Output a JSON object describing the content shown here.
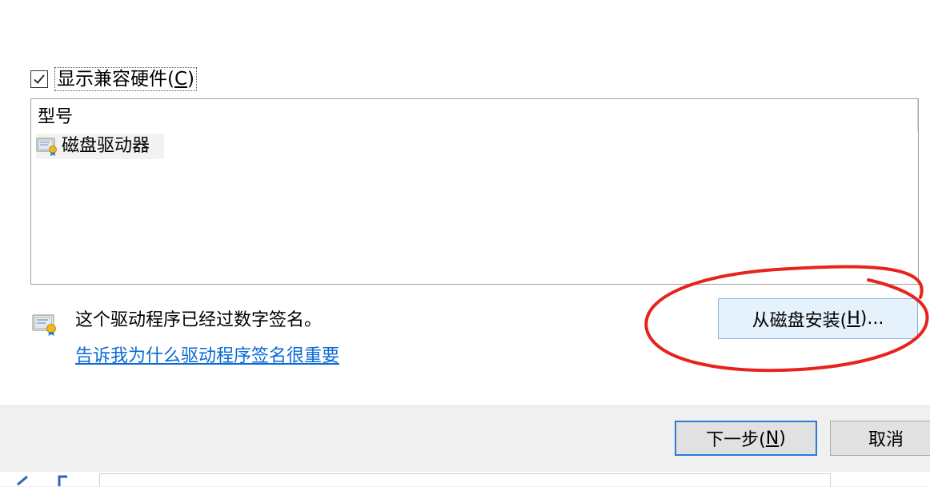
{
  "compat": {
    "label": "显示兼容硬件(C)",
    "label_pre": "显示兼容硬件(",
    "label_key": "C",
    "label_post": ")",
    "checked": true
  },
  "model_list": {
    "header": "型号",
    "items": [
      {
        "label": "磁盘驱动器",
        "icon": "driver-certificate-icon"
      }
    ]
  },
  "signed": {
    "text": "这个驱动程序已经过数字签名。",
    "icon": "certificate-icon",
    "link": "告诉我为什么驱动程序签名很重要"
  },
  "have_disk": {
    "label": "从磁盘安装(H)...",
    "label_pre": "从磁盘安装(",
    "label_key": "H",
    "label_post": ")..."
  },
  "footer": {
    "next": {
      "label": "下一步(N)",
      "label_pre": "下一步(",
      "label_key": "N",
      "label_post": ")"
    },
    "cancel": "取消"
  },
  "colors": {
    "annotation": "#e8231b",
    "link": "#0a6ad6",
    "button_focus_border": "#2b7bd6",
    "button_hover_bg": "#e5f1fb"
  }
}
